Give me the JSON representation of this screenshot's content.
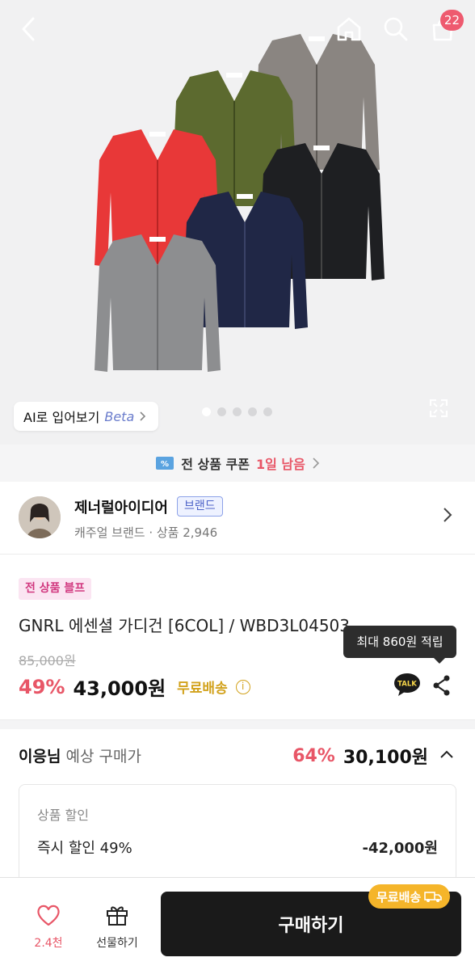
{
  "header": {
    "cart_count": "22",
    "icons": [
      "back-icon",
      "home-icon",
      "search-icon",
      "cart-icon"
    ]
  },
  "gallery": {
    "ai_try_label": "AI로 입어보기",
    "ai_try_beta": "Beta",
    "slide_count": 5,
    "active_slide": 1,
    "cardigan_colors": [
      "#8a8581",
      "#5c6a2f",
      "#e83838",
      "#1e1f22",
      "#202746",
      "#8d8e90"
    ]
  },
  "coupon_bar": {
    "text": "전 상품 쿠폰",
    "highlight": "1일 남음"
  },
  "brand": {
    "name": "제너럴아이디어",
    "tag": "브랜드",
    "subtitle": "캐주얼 브랜드 · 상품 2,946"
  },
  "product": {
    "promo_tag": "전 상품 블프",
    "title": "GNRL 에센셜 가디건 [6COL] / WBD3L04503",
    "original_price": "85,000원",
    "discount": "49%",
    "price": "43,000원",
    "shipping": "무료배송",
    "points_tooltip": "최대 860원 적립",
    "talk_label": "TALK"
  },
  "estimate": {
    "user": "이응님",
    "label": "예상 구매가",
    "discount": "64%",
    "price": "30,100원"
  },
  "discount_detail": {
    "heading": "상품 할인",
    "label": "즉시 할인 49%",
    "value": "-42,000원"
  },
  "bottom_bar": {
    "like_count": "2.4천",
    "gift_label": "선물하기",
    "buy_label": "구매하기",
    "buy_shipping": "무료배송"
  },
  "colors": {
    "accent_red": "#e85667",
    "shipping_gold": "#d2a21c",
    "buy_button": "#1a1a1a"
  }
}
